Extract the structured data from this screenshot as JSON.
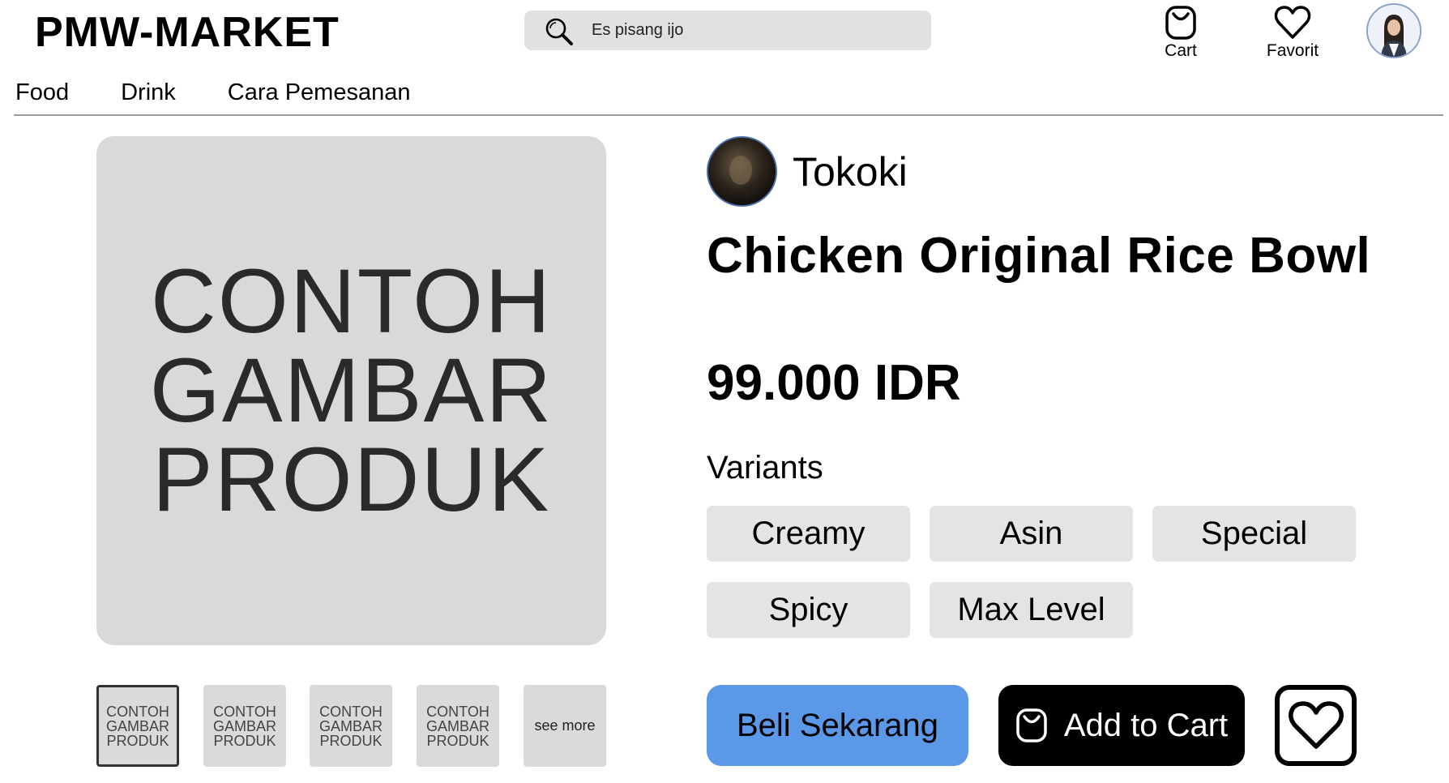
{
  "header": {
    "logo": "PMW-MARKET",
    "search": {
      "value": "Es pisang ijo",
      "icon": "search-icon"
    },
    "cart_label": "Cart",
    "favorite_label": "Favorit"
  },
  "nav": {
    "items": [
      {
        "label": "Food"
      },
      {
        "label": "Drink"
      },
      {
        "label": "Cara Pemesanan"
      }
    ]
  },
  "gallery": {
    "main_image_text": "CONTOH\nGAMBAR\nPRODUK",
    "thumbnails": [
      {
        "text": "CONTOH\nGAMBAR\nPRODUK",
        "active": true
      },
      {
        "text": "CONTOH\nGAMBAR\nPRODUK",
        "active": false
      },
      {
        "text": "CONTOH\nGAMBAR\nPRODUK",
        "active": false
      },
      {
        "text": "CONTOH\nGAMBAR\nPRODUK",
        "active": false
      }
    ],
    "see_more_label": "see more"
  },
  "product": {
    "store_name": "Tokoki",
    "title": "Chicken Original Rice Bowl",
    "price": "99.000 IDR",
    "variants_label": "Variants",
    "variants": [
      {
        "label": "Creamy"
      },
      {
        "label": "Asin"
      },
      {
        "label": "Special"
      },
      {
        "label": "Spicy"
      },
      {
        "label": "Max Level"
      }
    ]
  },
  "actions": {
    "buy_now_label": "Beli Sekarang",
    "add_to_cart_label": "Add to Cart"
  },
  "colors": {
    "buy_button": "#5b98e8",
    "add_to_cart_button": "#000000",
    "chip": "#e4e4e4",
    "placeholder": "#d9d9d9"
  }
}
